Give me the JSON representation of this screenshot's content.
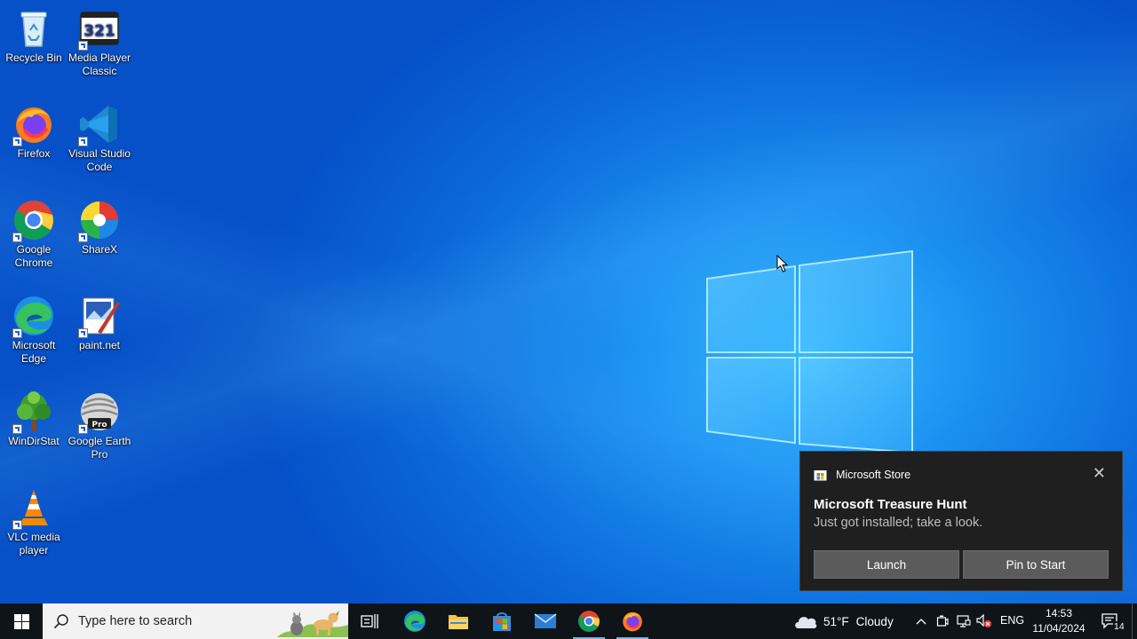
{
  "desktop": {
    "icons": [
      {
        "label": "Recycle Bin",
        "name": "recycle-bin-icon"
      },
      {
        "label": "Media Player Classic",
        "name": "media-player-classic-icon"
      },
      {
        "label": "Firefox",
        "name": "firefox-icon"
      },
      {
        "label": "Visual Studio Code",
        "name": "vscode-icon"
      },
      {
        "label": "Google Chrome",
        "name": "chrome-icon"
      },
      {
        "label": "ShareX",
        "name": "sharex-icon"
      },
      {
        "label": "Microsoft Edge",
        "name": "edge-icon"
      },
      {
        "label": "paint.net",
        "name": "paintnet-icon"
      },
      {
        "label": "WinDirStat",
        "name": "windirstat-icon"
      },
      {
        "label": "Google Earth Pro",
        "name": "google-earth-pro-icon"
      },
      {
        "label": "VLC media player",
        "name": "vlc-icon"
      }
    ],
    "mpc_badge": "321",
    "earth_badge": "Pro"
  },
  "toast": {
    "app_name": "Microsoft Store",
    "close_glyph": "✕",
    "title": "Microsoft Treasure Hunt",
    "body": "Just got installed; take a look.",
    "buttons": [
      "Launch",
      "Pin to Start"
    ]
  },
  "taskbar": {
    "search_placeholder": "Type here to search",
    "pinned": [
      "task-view",
      "edge",
      "file-explorer",
      "microsoft-store",
      "mail",
      "chrome",
      "firefox"
    ],
    "weather": {
      "temp": "51°F",
      "condition": "Cloudy"
    },
    "language": "ENG",
    "time": "14:53",
    "date": "11/04/2024",
    "notification_count": "14",
    "tray_chevron": "^"
  },
  "colors": {
    "desktop_blue": "#0b68d8",
    "toast_bg": "#1f1f1f",
    "taskbar_bg": "#0e1418",
    "active_underline": "#7fb3e8"
  }
}
